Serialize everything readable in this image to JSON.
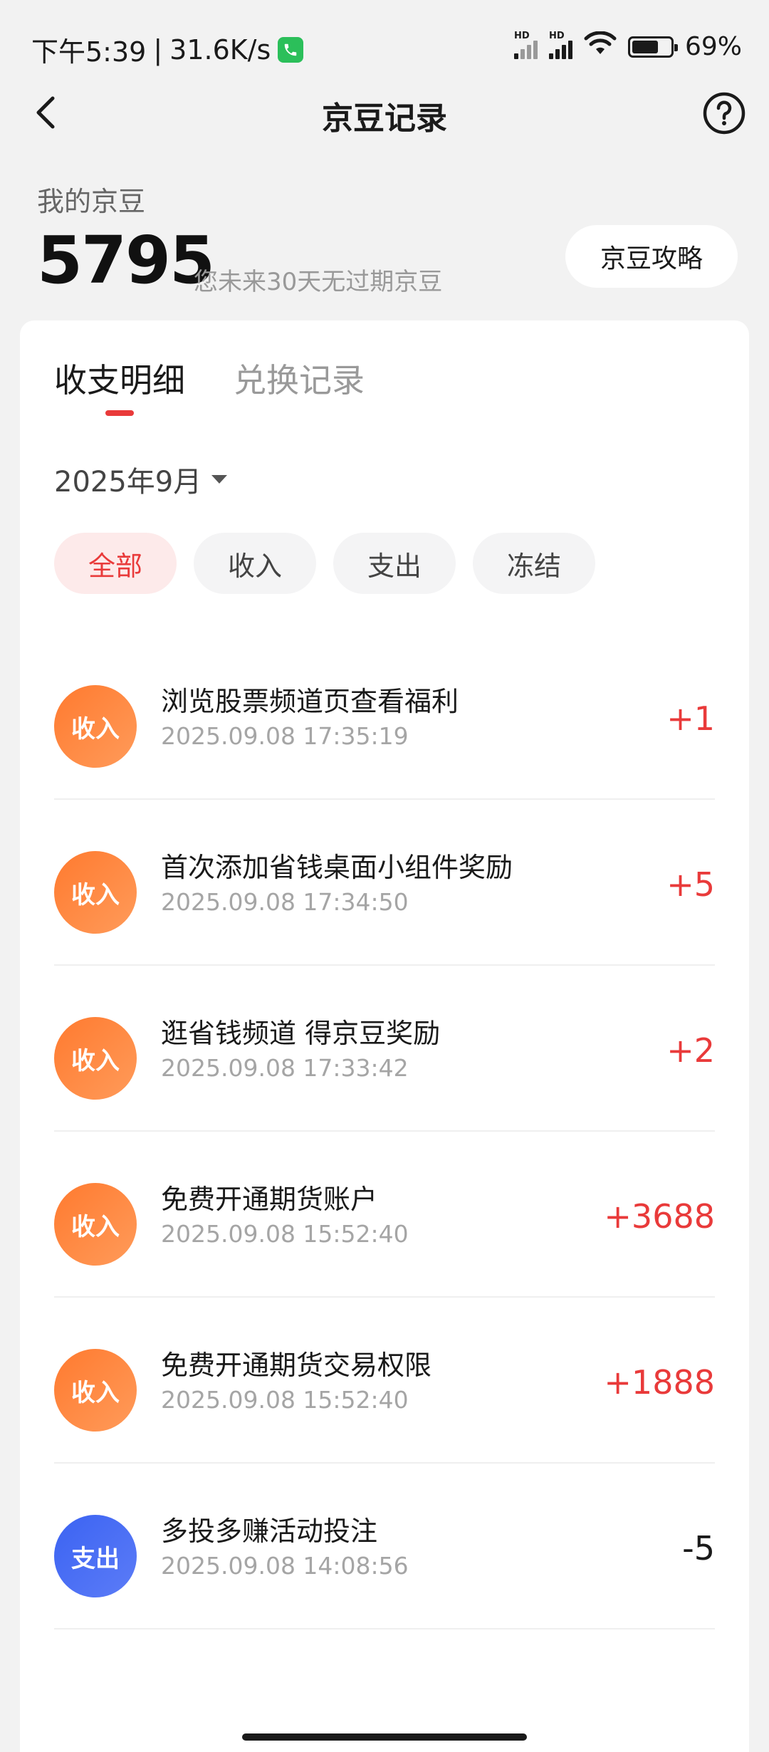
{
  "status": {
    "time": "下午5:39",
    "speed": "31.6K/s",
    "hd1": "HD",
    "hd2": "HD",
    "battery_percent": 69,
    "battery_text": "69%"
  },
  "nav": {
    "title": "京豆记录",
    "back_icon": "chevron-left-icon",
    "help_icon": "question-circle-icon"
  },
  "summary": {
    "label": "我的京豆",
    "value": "5795",
    "note": "您未来30天无过期京豆",
    "guide_label": "京豆攻略"
  },
  "tabs": [
    {
      "label": "收支明细",
      "active": true
    },
    {
      "label": "兑换记录",
      "active": false
    }
  ],
  "month": "2025年9月",
  "filters": [
    {
      "label": "全部",
      "active": true
    },
    {
      "label": "收入",
      "active": false
    },
    {
      "label": "支出",
      "active": false
    },
    {
      "label": "冻结",
      "active": false
    }
  ],
  "records": [
    {
      "type": "收入",
      "title": "浏览股票频道页查看福利",
      "time": "2025.09.08 17:35:19",
      "amount": "+1"
    },
    {
      "type": "收入",
      "title": "首次添加省钱桌面小组件奖励",
      "time": "2025.09.08 17:34:50",
      "amount": "+5"
    },
    {
      "type": "收入",
      "title": "逛省钱频道 得京豆奖励",
      "time": "2025.09.08 17:33:42",
      "amount": "+2"
    },
    {
      "type": "收入",
      "title": "免费开通期货账户",
      "time": "2025.09.08 15:52:40",
      "amount": "+3688"
    },
    {
      "type": "收入",
      "title": "免费开通期货交易权限",
      "time": "2025.09.08 15:52:40",
      "amount": "+1888"
    },
    {
      "type": "支出",
      "title": "多投多赚活动投注",
      "time": "2025.09.08 14:08:56",
      "amount": "-5"
    }
  ],
  "colors": {
    "accent_red": "#e93a3a",
    "income_orange": "#ff7a2f",
    "expense_blue": "#3b63f2"
  }
}
